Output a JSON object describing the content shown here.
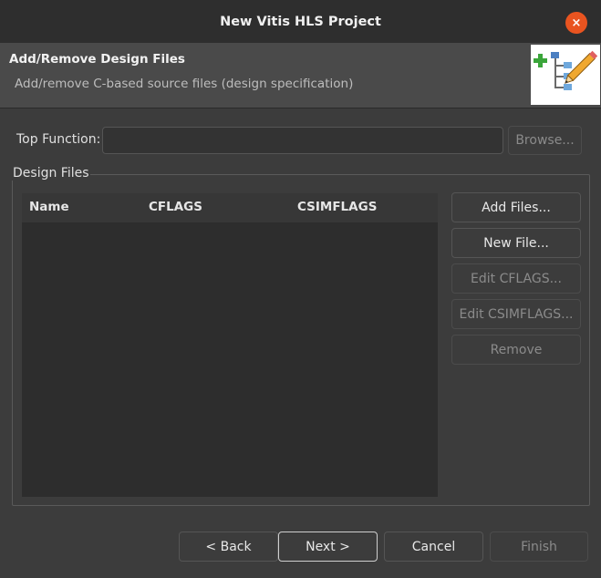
{
  "window": {
    "title": "New Vitis HLS Project",
    "close_icon": "×"
  },
  "header": {
    "title": "Add/Remove Design Files",
    "description": "Add/remove C-based source files (design specification)"
  },
  "top_function": {
    "label": "Top Function:",
    "value": "",
    "browse_label": "Browse..."
  },
  "design_files": {
    "group_label": "Design Files",
    "columns": [
      "Name",
      "CFLAGS",
      "CSIMFLAGS"
    ],
    "rows": []
  },
  "side_buttons": {
    "add_files": "Add Files...",
    "new_file": "New File...",
    "edit_cflags": "Edit CFLAGS...",
    "edit_csimflags": "Edit CSIMFLAGS...",
    "remove": "Remove"
  },
  "footer": {
    "back": "< Back",
    "next": "Next >",
    "cancel": "Cancel",
    "finish": "Finish"
  },
  "colors": {
    "accent_close": "#e95420",
    "banner_bg": "#ffffff"
  }
}
